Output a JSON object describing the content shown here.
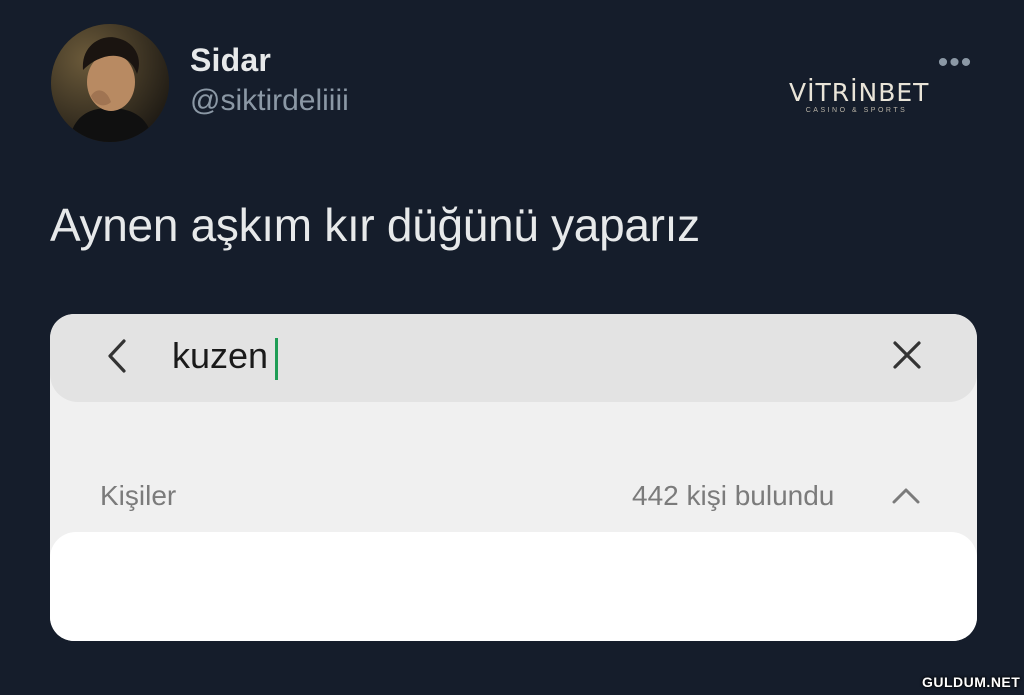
{
  "tweet": {
    "display_name": "Sidar",
    "handle": "@siktirdeliiii",
    "more_icon": "more-horizontal-icon",
    "text": "Aynen aşkım kır düğünü yaparız"
  },
  "brand": {
    "name": "VİTRİNBET",
    "tagline": "CASINO & SPORTS"
  },
  "screenshot": {
    "search": {
      "value": "kuzen",
      "back_icon": "chevron-left-icon",
      "clear_icon": "close-icon"
    },
    "contacts": {
      "label": "Kişiler",
      "count_text": "442 kişi bulundu",
      "collapse_icon": "chevron-up-icon"
    }
  },
  "watermark": "GULDUM.NET",
  "colors": {
    "background": "#151d2b",
    "text_primary": "#e7e9ea",
    "text_secondary": "#8b98a5",
    "caret": "#1f9d55"
  }
}
